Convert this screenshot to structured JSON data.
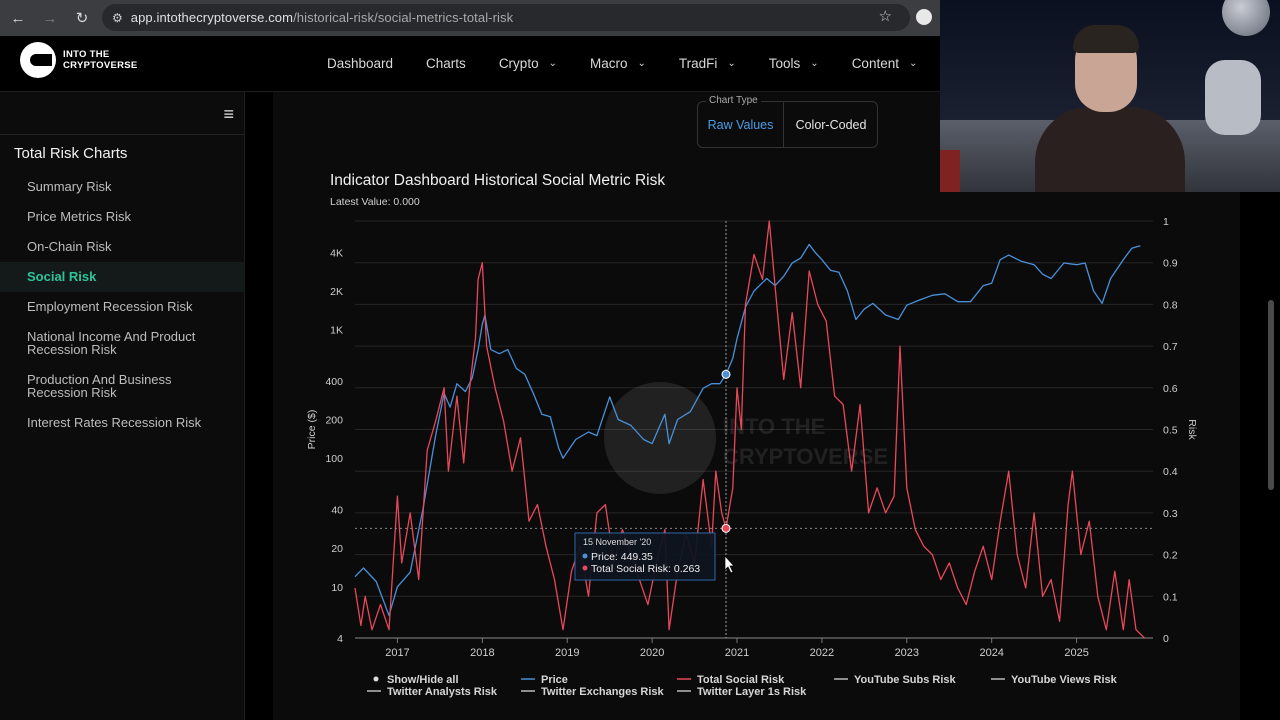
{
  "browser": {
    "url_host": "app.intothecryptoverse.com",
    "url_path": "/historical-risk/social-metrics-total-risk"
  },
  "header": {
    "logo_line1": "INTO THE",
    "logo_line2": "CRYPTOVERSE",
    "nav": [
      {
        "label": "Dashboard",
        "dropdown": false
      },
      {
        "label": "Charts",
        "dropdown": false
      },
      {
        "label": "Crypto",
        "dropdown": true
      },
      {
        "label": "Macro",
        "dropdown": true
      },
      {
        "label": "TradFi",
        "dropdown": true
      },
      {
        "label": "Tools",
        "dropdown": true
      },
      {
        "label": "Content",
        "dropdown": true
      }
    ]
  },
  "sidebar": {
    "title": "Total Risk Charts",
    "items": [
      {
        "label": "Summary Risk",
        "active": false
      },
      {
        "label": "Price Metrics Risk",
        "active": false
      },
      {
        "label": "On-Chain Risk",
        "active": false
      },
      {
        "label": "Social Risk",
        "active": true
      },
      {
        "label": "Employment Recession Risk",
        "active": false
      },
      {
        "label": "National Income And Product Recession Risk",
        "active": false
      },
      {
        "label": "Production And Business Recession Risk",
        "active": false
      },
      {
        "label": "Interest Rates Recession Risk",
        "active": false
      }
    ]
  },
  "chart_type": {
    "legend": "Chart Type",
    "options": [
      "Raw Values",
      "Color-Coded"
    ],
    "selected": "Raw Values"
  },
  "chart_header": {
    "title": "Indicator Dashboard Historical Social Metric Risk",
    "latest": "Latest Value: 0.000"
  },
  "colors": {
    "price": "#4a90d9",
    "risk": "#e8485a",
    "grid": "#262626"
  },
  "chart_data": {
    "type": "line",
    "title": "Indicator Dashboard Historical Social Metric Risk",
    "xlabel": "",
    "ylabel_left": "Price ($)",
    "ylabel_right": "Risk",
    "x_ticks": [
      "2017",
      "2018",
      "2019",
      "2020",
      "2021",
      "2022",
      "2023",
      "2024",
      "2025"
    ],
    "left_ticks": [
      4,
      10,
      20,
      40,
      100,
      200,
      400,
      "1K",
      "2K",
      "4K"
    ],
    "right_ticks": [
      0,
      0.1,
      0.2,
      0.3,
      0.4,
      0.5,
      0.6,
      0.7,
      0.8,
      0.9,
      1
    ],
    "left_scale": "log",
    "left_range": [
      4,
      7000
    ],
    "right_range": [
      0,
      1
    ],
    "x_range": [
      2016.5,
      2025.9
    ],
    "grid": true,
    "legend_position": "bottom",
    "series": [
      {
        "name": "Price",
        "axis": "left",
        "points": [
          [
            2016.5,
            12
          ],
          [
            2016.6,
            14
          ],
          [
            2016.75,
            11
          ],
          [
            2016.9,
            6
          ],
          [
            2017.0,
            10
          ],
          [
            2017.15,
            13
          ],
          [
            2017.3,
            40
          ],
          [
            2017.45,
            150
          ],
          [
            2017.55,
            320
          ],
          [
            2017.62,
            250
          ],
          [
            2017.7,
            380
          ],
          [
            2017.8,
            330
          ],
          [
            2017.88,
            420
          ],
          [
            2017.95,
            700
          ],
          [
            2018.0,
            1100
          ],
          [
            2018.03,
            1300
          ],
          [
            2018.1,
            700
          ],
          [
            2018.2,
            650
          ],
          [
            2018.3,
            700
          ],
          [
            2018.4,
            500
          ],
          [
            2018.5,
            450
          ],
          [
            2018.6,
            320
          ],
          [
            2018.7,
            220
          ],
          [
            2018.8,
            210
          ],
          [
            2018.9,
            120
          ],
          [
            2018.95,
            100
          ],
          [
            2019.1,
            140
          ],
          [
            2019.25,
            160
          ],
          [
            2019.35,
            150
          ],
          [
            2019.5,
            300
          ],
          [
            2019.6,
            200
          ],
          [
            2019.75,
            180
          ],
          [
            2019.9,
            140
          ],
          [
            2020.0,
            130
          ],
          [
            2020.15,
            220
          ],
          [
            2020.2,
            130
          ],
          [
            2020.3,
            200
          ],
          [
            2020.45,
            230
          ],
          [
            2020.6,
            350
          ],
          [
            2020.7,
            380
          ],
          [
            2020.8,
            380
          ],
          [
            2020.87,
            449
          ],
          [
            2020.95,
            600
          ],
          [
            2021.0,
            850
          ],
          [
            2021.1,
            1500
          ],
          [
            2021.2,
            2000
          ],
          [
            2021.35,
            2500
          ],
          [
            2021.45,
            2200
          ],
          [
            2021.55,
            2600
          ],
          [
            2021.65,
            3300
          ],
          [
            2021.75,
            3600
          ],
          [
            2021.85,
            4600
          ],
          [
            2021.92,
            4000
          ],
          [
            2022.0,
            3500
          ],
          [
            2022.1,
            2900
          ],
          [
            2022.2,
            2800
          ],
          [
            2022.3,
            2000
          ],
          [
            2022.4,
            1200
          ],
          [
            2022.5,
            1450
          ],
          [
            2022.6,
            1600
          ],
          [
            2022.75,
            1300
          ],
          [
            2022.9,
            1200
          ],
          [
            2023.0,
            1550
          ],
          [
            2023.15,
            1700
          ],
          [
            2023.3,
            1850
          ],
          [
            2023.45,
            1900
          ],
          [
            2023.6,
            1650
          ],
          [
            2023.75,
            1650
          ],
          [
            2023.9,
            2200
          ],
          [
            2024.0,
            2300
          ],
          [
            2024.1,
            3500
          ],
          [
            2024.2,
            3800
          ],
          [
            2024.35,
            3400
          ],
          [
            2024.5,
            3200
          ],
          [
            2024.6,
            2700
          ],
          [
            2024.7,
            2500
          ],
          [
            2024.85,
            3300
          ],
          [
            2025.0,
            3200
          ],
          [
            2025.1,
            3300
          ],
          [
            2025.2,
            2000
          ],
          [
            2025.3,
            1600
          ],
          [
            2025.4,
            2500
          ],
          [
            2025.55,
            3500
          ],
          [
            2025.65,
            4300
          ],
          [
            2025.75,
            4500
          ]
        ]
      },
      {
        "name": "Total Social Risk",
        "axis": "right",
        "points": [
          [
            2016.5,
            0.12
          ],
          [
            2016.57,
            0.03
          ],
          [
            2016.62,
            0.1
          ],
          [
            2016.7,
            0.02
          ],
          [
            2016.8,
            0.08
          ],
          [
            2016.9,
            0.02
          ],
          [
            2017.0,
            0.34
          ],
          [
            2017.05,
            0.18
          ],
          [
            2017.15,
            0.3
          ],
          [
            2017.25,
            0.14
          ],
          [
            2017.35,
            0.45
          ],
          [
            2017.45,
            0.52
          ],
          [
            2017.55,
            0.6
          ],
          [
            2017.6,
            0.4
          ],
          [
            2017.7,
            0.58
          ],
          [
            2017.78,
            0.42
          ],
          [
            2017.85,
            0.6
          ],
          [
            2017.92,
            0.72
          ],
          [
            2017.95,
            0.86
          ],
          [
            2018.0,
            0.9
          ],
          [
            2018.05,
            0.7
          ],
          [
            2018.15,
            0.6
          ],
          [
            2018.25,
            0.52
          ],
          [
            2018.35,
            0.4
          ],
          [
            2018.45,
            0.48
          ],
          [
            2018.55,
            0.28
          ],
          [
            2018.65,
            0.32
          ],
          [
            2018.75,
            0.22
          ],
          [
            2018.85,
            0.14
          ],
          [
            2018.95,
            0.02
          ],
          [
            2019.05,
            0.16
          ],
          [
            2019.15,
            0.22
          ],
          [
            2019.25,
            0.1
          ],
          [
            2019.35,
            0.3
          ],
          [
            2019.45,
            0.32
          ],
          [
            2019.55,
            0.18
          ],
          [
            2019.65,
            0.26
          ],
          [
            2019.75,
            0.2
          ],
          [
            2019.85,
            0.14
          ],
          [
            2019.95,
            0.08
          ],
          [
            2020.05,
            0.18
          ],
          [
            2020.15,
            0.26
          ],
          [
            2020.2,
            0.02
          ],
          [
            2020.3,
            0.16
          ],
          [
            2020.4,
            0.25
          ],
          [
            2020.5,
            0.18
          ],
          [
            2020.6,
            0.38
          ],
          [
            2020.7,
            0.22
          ],
          [
            2020.75,
            0.4
          ],
          [
            2020.82,
            0.3
          ],
          [
            2020.87,
            0.263
          ],
          [
            2020.95,
            0.36
          ],
          [
            2021.0,
            0.6
          ],
          [
            2021.05,
            0.5
          ],
          [
            2021.1,
            0.8
          ],
          [
            2021.2,
            0.92
          ],
          [
            2021.3,
            0.86
          ],
          [
            2021.38,
            1.0
          ],
          [
            2021.45,
            0.84
          ],
          [
            2021.55,
            0.62
          ],
          [
            2021.65,
            0.78
          ],
          [
            2021.75,
            0.6
          ],
          [
            2021.85,
            0.88
          ],
          [
            2021.95,
            0.8
          ],
          [
            2022.05,
            0.76
          ],
          [
            2022.15,
            0.58
          ],
          [
            2022.25,
            0.56
          ],
          [
            2022.35,
            0.4
          ],
          [
            2022.45,
            0.56
          ],
          [
            2022.55,
            0.3
          ],
          [
            2022.65,
            0.36
          ],
          [
            2022.75,
            0.3
          ],
          [
            2022.85,
            0.34
          ],
          [
            2022.92,
            0.7
          ],
          [
            2023.0,
            0.36
          ],
          [
            2023.1,
            0.26
          ],
          [
            2023.2,
            0.22
          ],
          [
            2023.3,
            0.2
          ],
          [
            2023.4,
            0.14
          ],
          [
            2023.5,
            0.18
          ],
          [
            2023.6,
            0.12
          ],
          [
            2023.7,
            0.08
          ],
          [
            2023.8,
            0.16
          ],
          [
            2023.9,
            0.22
          ],
          [
            2024.0,
            0.14
          ],
          [
            2024.1,
            0.28
          ],
          [
            2024.2,
            0.4
          ],
          [
            2024.3,
            0.2
          ],
          [
            2024.4,
            0.12
          ],
          [
            2024.5,
            0.3
          ],
          [
            2024.6,
            0.1
          ],
          [
            2024.7,
            0.14
          ],
          [
            2024.8,
            0.04
          ],
          [
            2024.9,
            0.32
          ],
          [
            2024.95,
            0.4
          ],
          [
            2025.05,
            0.2
          ],
          [
            2025.15,
            0.28
          ],
          [
            2025.25,
            0.1
          ],
          [
            2025.35,
            0.02
          ],
          [
            2025.45,
            0.16
          ],
          [
            2025.55,
            0.02
          ],
          [
            2025.62,
            0.14
          ],
          [
            2025.7,
            0.02
          ],
          [
            2025.8,
            0.0
          ]
        ]
      }
    ],
    "tooltip": {
      "date": "15 November '20",
      "price_label": "Price: 449.35",
      "risk_label": "Total Social Risk: 0.263",
      "x": 2020.87,
      "price": 449.35,
      "risk": 0.263
    },
    "legend": [
      {
        "label": "Show/Hide all",
        "marker": "dot",
        "color": "#dddddd"
      },
      {
        "label": "Price",
        "marker": "line",
        "color": "#4a90d9"
      },
      {
        "label": "Total Social Risk",
        "marker": "line",
        "color": "#e8485a"
      },
      {
        "label": "YouTube Subs Risk",
        "marker": "line",
        "color": "#bbbbbb"
      },
      {
        "label": "YouTube Views Risk",
        "marker": "line",
        "color": "#bbbbbb"
      },
      {
        "label": "Twitter Analysts Risk",
        "marker": "line",
        "color": "#bbbbbb"
      },
      {
        "label": "Twitter Exchanges Risk",
        "marker": "line",
        "color": "#bbbbbb"
      },
      {
        "label": "Twitter Layer 1s Risk",
        "marker": "line",
        "color": "#bbbbbb"
      }
    ],
    "watermark": "INTO THE CRYPTOVERSE"
  }
}
